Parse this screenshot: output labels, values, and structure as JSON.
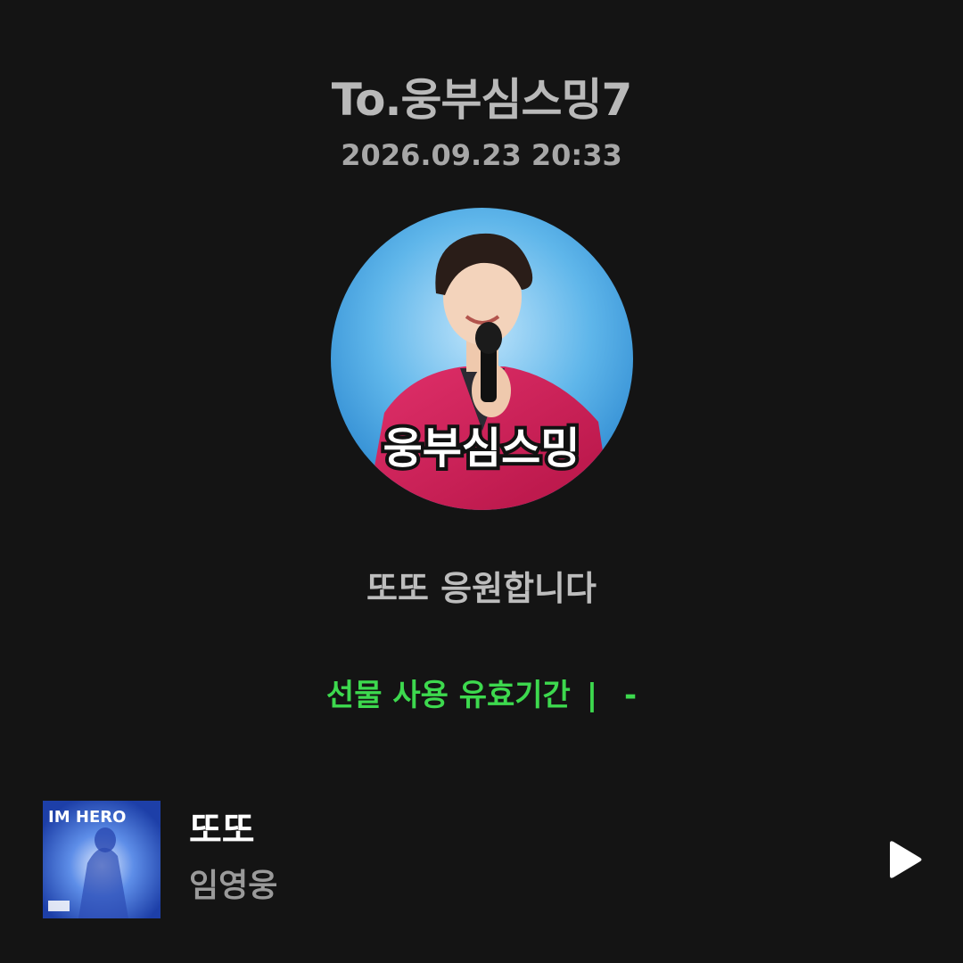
{
  "header": {
    "recipient": "To.웅부심스밍7",
    "timestamp": "2026.09.23 20:33"
  },
  "avatar": {
    "caption": "웅부심스밍"
  },
  "message": "또또 응원합니다",
  "validity": {
    "label": "선물 사용 유효기간",
    "separator": "|",
    "value": "-"
  },
  "track": {
    "title": "또또",
    "artist": "임영웅",
    "album_text": "IM HERO"
  },
  "icons": {
    "play": "play-icon"
  },
  "colors": {
    "background": "#141414",
    "accent_green": "#3dd94e",
    "title_white": "#ffffff"
  }
}
